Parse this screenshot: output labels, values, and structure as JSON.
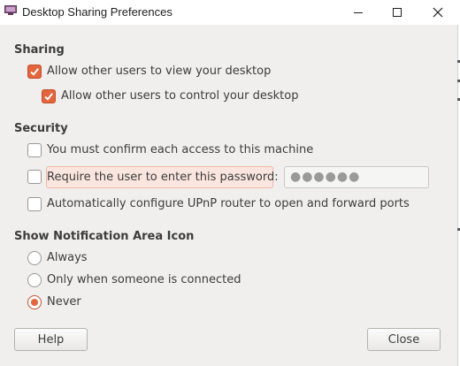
{
  "window": {
    "title": "Desktop Sharing Preferences",
    "controls": [
      "minimize-icon",
      "maximize-icon",
      "close-icon"
    ]
  },
  "sharing": {
    "heading": "Sharing",
    "view_desktop": {
      "label": "Allow other users to view your desktop",
      "checked": true
    },
    "control_desktop": {
      "label": "Allow other users to control your desktop",
      "checked": true
    }
  },
  "security": {
    "heading": "Security",
    "confirm_access": {
      "label": "You must confirm each access to this machine",
      "checked": false
    },
    "require_password": {
      "label": "Require the user to enter this password:",
      "checked": false
    },
    "password": {
      "value": "●●●●●●"
    },
    "upnp": {
      "label": "Automatically configure UPnP router to open and forward ports",
      "checked": false
    }
  },
  "notification": {
    "heading": "Show Notification Area Icon",
    "options": [
      {
        "label": "Always",
        "selected": false
      },
      {
        "label": "Only when someone is connected",
        "selected": false
      },
      {
        "label": "Never",
        "selected": true
      }
    ]
  },
  "buttons": {
    "help": "Help",
    "close": "Close"
  },
  "colors": {
    "accent": "#e2653d",
    "warning_bg": "#fbe6df"
  }
}
